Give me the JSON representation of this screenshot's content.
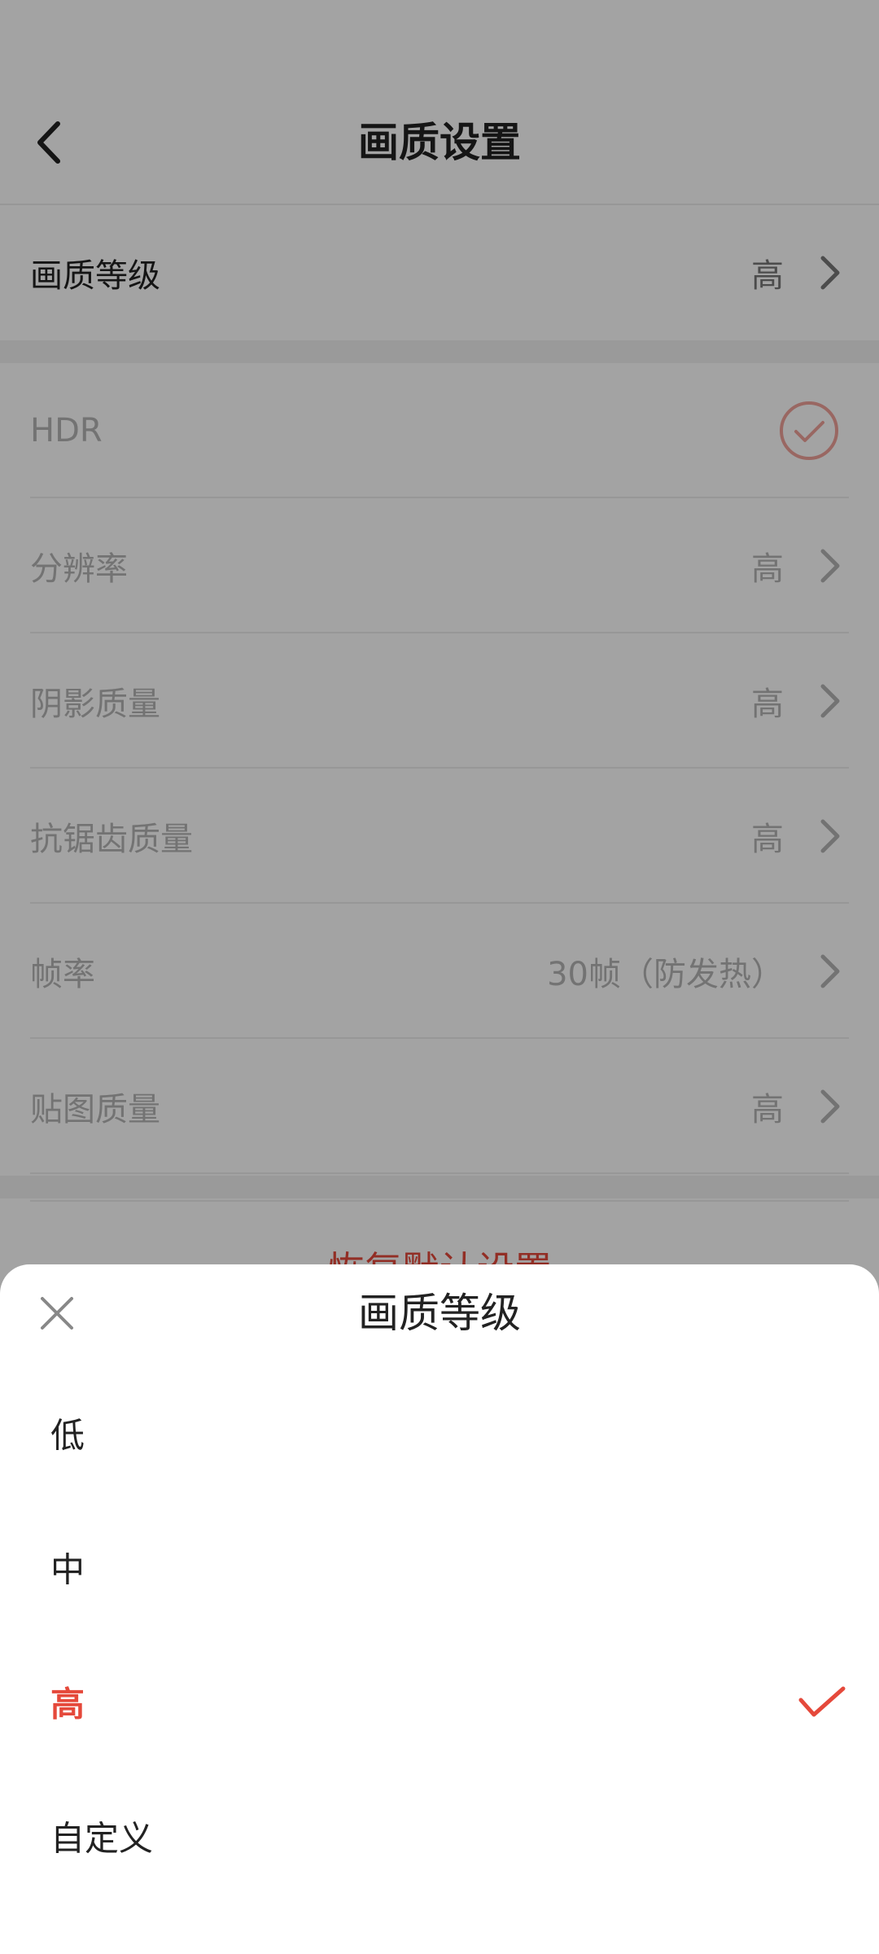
{
  "header": {
    "title": "画质设置"
  },
  "quality_level_row": {
    "label": "画质等级",
    "value": "高"
  },
  "settings": {
    "hdr": {
      "label": "HDR"
    },
    "resolution": {
      "label": "分辨率",
      "value": "高"
    },
    "shadow": {
      "label": "阴影质量",
      "value": "高"
    },
    "antialias": {
      "label": "抗锯齿质量",
      "value": "高"
    },
    "framerate": {
      "label": "帧率",
      "value": "30帧（防发热）"
    },
    "texture": {
      "label": "贴图质量",
      "value": "高"
    }
  },
  "reset_button": {
    "label": "恢复默认设置"
  },
  "sheet": {
    "title": "画质等级",
    "options": [
      {
        "label": "低"
      },
      {
        "label": "中"
      },
      {
        "label": "高"
      },
      {
        "label": "自定义"
      }
    ],
    "selected_index": 2
  },
  "colors": {
    "accent": "#e5493b",
    "overlay": "rgba(0,0,0,0.36)",
    "text": "#222222",
    "muted": "#b5b5b5"
  }
}
